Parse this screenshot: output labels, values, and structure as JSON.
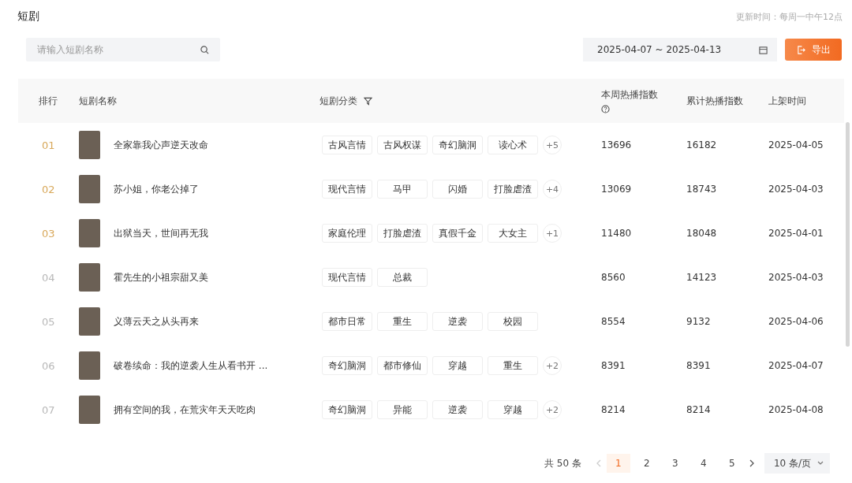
{
  "page": {
    "title": "短剧",
    "update_note": "更新时间：每周一中午12点"
  },
  "search": {
    "placeholder": "请输入短剧名称"
  },
  "date_range": {
    "value": "2025-04-07 ~ 2025-04-13"
  },
  "export_button": {
    "label": "导出"
  },
  "table": {
    "columns": [
      {
        "label": "排行"
      },
      {
        "label": "短剧名称"
      },
      {
        "label": "短剧分类",
        "filter": true
      },
      {
        "label": "本周热播指数",
        "help": true
      },
      {
        "label": "累计热播指数"
      },
      {
        "label": "上架时间"
      }
    ],
    "rows": [
      {
        "rank": "01",
        "highlighted": true,
        "name": "全家靠我心声逆天改命",
        "tags": [
          "古风言情",
          "古风权谋",
          "奇幻脑洞",
          "读心术"
        ],
        "more": "+5",
        "weekly": "13696",
        "total": "16182",
        "date": "2025-04-05"
      },
      {
        "rank": "02",
        "highlighted": true,
        "name": "苏小姐，你老公掉了",
        "tags": [
          "现代言情",
          "马甲",
          "闪婚",
          "打脸虐渣"
        ],
        "more": "+4",
        "weekly": "13069",
        "total": "18743",
        "date": "2025-04-03"
      },
      {
        "rank": "03",
        "highlighted": true,
        "name": "出狱当天，世间再无我",
        "tags": [
          "家庭伦理",
          "打脸虐渣",
          "真假千金",
          "大女主"
        ],
        "more": "+1",
        "weekly": "11480",
        "total": "18048",
        "date": "2025-04-01"
      },
      {
        "rank": "04",
        "highlighted": false,
        "name": "霍先生的小祖宗甜又美",
        "tags": [
          "现代言情",
          "总裁"
        ],
        "weekly": "8560",
        "total": "14123",
        "date": "2025-04-03"
      },
      {
        "rank": "05",
        "highlighted": false,
        "name": "义薄云天之从头再来",
        "tags": [
          "都市日常",
          "重生",
          "逆袭",
          "校园"
        ],
        "weekly": "8554",
        "total": "9132",
        "date": "2025-04-06"
      },
      {
        "rank": "06",
        "highlighted": false,
        "name": "破卷续命：我的逆袭人生从看书开 ...",
        "tags": [
          "奇幻脑洞",
          "都市修仙",
          "穿越",
          "重生"
        ],
        "more": "+2",
        "weekly": "8391",
        "total": "8391",
        "date": "2025-04-07"
      },
      {
        "rank": "07",
        "highlighted": false,
        "name": "拥有空间的我，在荒灾年天天吃肉",
        "tags": [
          "奇幻脑洞",
          "异能",
          "逆袭",
          "穿越"
        ],
        "more": "+2",
        "weekly": "8214",
        "total": "8214",
        "date": "2025-04-08"
      }
    ]
  },
  "pagination": {
    "total": "共 50 条",
    "pages": [
      {
        "label": "1",
        "selected": true
      },
      {
        "label": "2",
        "selected": false
      },
      {
        "label": "3",
        "selected": false
      },
      {
        "label": "4",
        "selected": false
      },
      {
        "label": "5",
        "selected": false
      }
    ],
    "page_size": "10 条/页"
  }
}
